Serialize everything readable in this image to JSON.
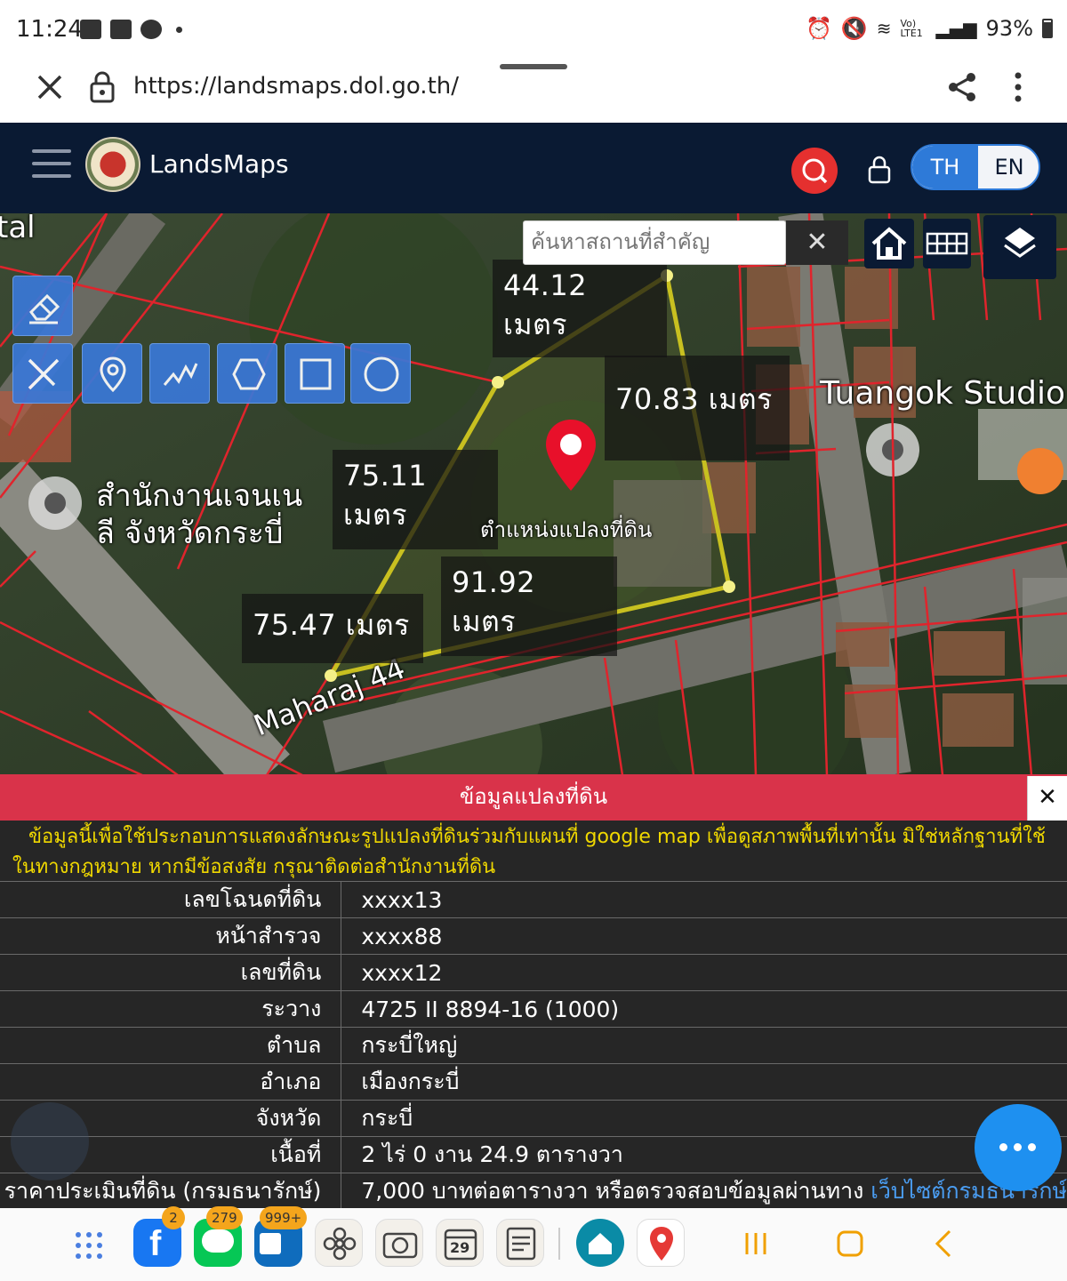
{
  "status_bar": {
    "time": "11:24",
    "battery": "93%",
    "network": "Vo) LTE1"
  },
  "browser": {
    "url": "https://landsmaps.dol.go.th/"
  },
  "header": {
    "brand": "LandsMaps",
    "lang_th": "TH",
    "lang_en": "EN"
  },
  "map": {
    "search_placeholder": "ค้นหาสถานที่สำคัญ",
    "clear_label": "✕",
    "measurements": [
      "44.12 เมตร",
      "70.83 เมตร",
      "75.11 เมตร",
      "91.92 เมตร",
      "75.47 เมตร"
    ],
    "pin_label": "ตำแหน่งแปลงที่ดิน",
    "place_labels": {
      "tal": "tal",
      "studio": "Tuangok Studio",
      "office_line1": "สำนักงานเจนเน",
      "office_line2": "ลี จังหวัดกระบี่",
      "road": "Maharaj 44"
    }
  },
  "panel": {
    "title": "ข้อมูลแปลงที่ดิน",
    "close_label": "✕",
    "disclaimer": "ข้อมูลนี้เพื่อใช้ประกอบการแสดงลักษณะรูปแปลงที่ดินร่วมกับแผนที่ google map เพื่อดูสภาพพื้นที่เท่านั้น มิใช่หลักฐานที่ใช้ในทางกฎหมาย หากมีข้อสงสัย กรุณาติดต่อสำนักงานที่ดิน",
    "rows": [
      {
        "label": "เลขโฉนดที่ดิน",
        "value": "xxxx13"
      },
      {
        "label": "หน้าสำรวจ",
        "value": "xxxx88"
      },
      {
        "label": "เลขที่ดิน",
        "value": "xxxx12"
      },
      {
        "label": "ระวาง",
        "value": "4725 II 8894-16 (1000)"
      },
      {
        "label": "ตำบล",
        "value": "กระบี่ใหญ่"
      },
      {
        "label": "อำเภอ",
        "value": "เมืองกระบี่"
      },
      {
        "label": "จังหวัด",
        "value": "กระบี่"
      },
      {
        "label": "เนื้อที่",
        "value": "2 ไร่ 0 งาน 24.9 ตารางวา"
      },
      {
        "label": "ราคาประเมินที่ดิน (กรมธนารักษ์)",
        "value": "7,000 บาทต่อตารางวา หรือตรวจสอบข้อมูลผ่านทาง",
        "link": "เว็บไซต์กรมธนารักษ์"
      }
    ]
  },
  "dock": {
    "badges": {
      "facebook": "2",
      "line": "279",
      "outlook": "999+"
    },
    "calendar_day": "29"
  },
  "colors": {
    "header": "#0a1a33",
    "accent": "#2e7ad8",
    "panel_title": "#d9334a",
    "parcel_outline": "#c8c020",
    "boundary": "#e0242c"
  }
}
